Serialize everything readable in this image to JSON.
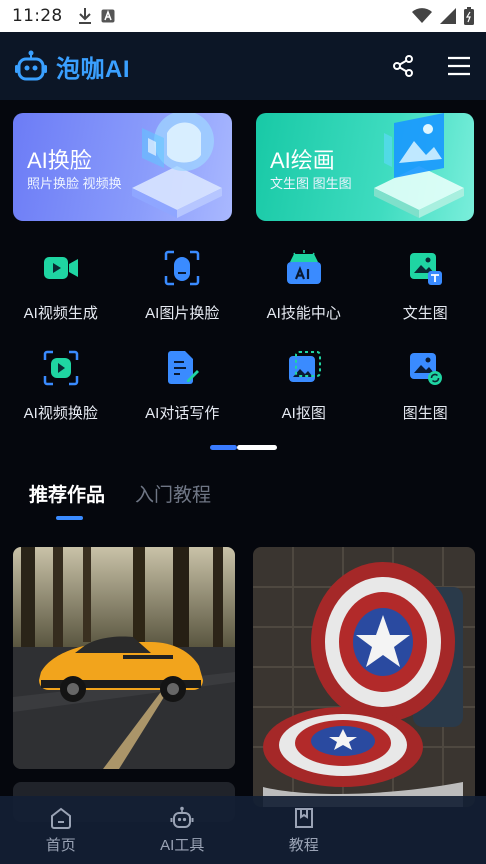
{
  "status_bar": {
    "time": "11:28",
    "icons": [
      "download-icon",
      "app-notify-icon",
      "wifi-icon",
      "signal-icon",
      "battery-icon"
    ]
  },
  "header": {
    "app_name": "泡咖AI",
    "logo_icon": "robot-icon",
    "actions": [
      "share-icon",
      "menu-icon"
    ]
  },
  "banners": [
    {
      "title": "AI换脸",
      "subtitle": "照片换脸 视频换",
      "color": "#7b8cf9"
    },
    {
      "title": "AI绘画",
      "subtitle": "文生图 图生图",
      "color": "#2ed3b4"
    }
  ],
  "tools": [
    {
      "label": "AI视频生成",
      "icon": "video-camera-icon"
    },
    {
      "label": "AI图片换脸",
      "icon": "face-scan-icon"
    },
    {
      "label": "AI技能中心",
      "icon": "ai-box-icon"
    },
    {
      "label": "文生图",
      "icon": "text-to-image-icon"
    },
    {
      "label": "AI视频换脸",
      "icon": "video-face-icon"
    },
    {
      "label": "AI对话写作",
      "icon": "write-doc-icon"
    },
    {
      "label": "AI抠图",
      "icon": "cutout-icon"
    },
    {
      "label": "图生图",
      "icon": "image-to-image-icon"
    }
  ],
  "tabs": [
    {
      "label": "推荐作品",
      "active": true
    },
    {
      "label": "入门教程",
      "active": false
    }
  ],
  "bottom_nav": [
    {
      "label": "首页",
      "icon": "home-icon"
    },
    {
      "label": "AI工具",
      "icon": "robot-icon"
    },
    {
      "label": "教程",
      "icon": "book-icon"
    },
    {
      "label": "",
      "icon": ""
    }
  ],
  "colors": {
    "accent": "#3a8bff",
    "icon_green": "#1fd5a2",
    "icon_blue": "#3a8bff",
    "background": "#05070d"
  }
}
